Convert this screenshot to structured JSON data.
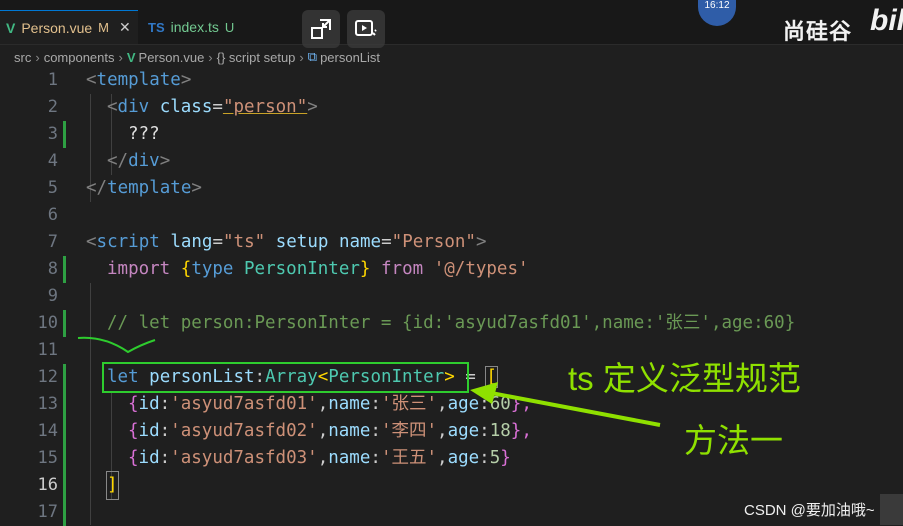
{
  "tabs": [
    {
      "icon": "V",
      "label": "Person.vue",
      "badge": "M",
      "close": "✕"
    },
    {
      "icon": "TS",
      "label": "index.ts",
      "badge": "U"
    }
  ],
  "clock": "16:12",
  "watermark": "尚硅谷",
  "watermark_logo": "bili",
  "breadcrumb": {
    "src": "src",
    "components": "components",
    "file": "Person.vue",
    "script": "{} script setup",
    "symbol": "personList"
  },
  "line_numbers": [
    "1",
    "2",
    "3",
    "4",
    "5",
    "6",
    "7",
    "8",
    "9",
    "10",
    "11",
    "12",
    "13",
    "14",
    "15",
    "16",
    "17"
  ],
  "code": {
    "l1_open": "<",
    "l1_tag": "template",
    "l1_close": ">",
    "l2_open": "<",
    "l2_tag": "div",
    "l2_attr": "class",
    "l2_eq": "=",
    "l2_val": "\"person\"",
    "l2_close": ">",
    "l3": "???",
    "l4_open": "</",
    "l4_tag": "div",
    "l4_close": ">",
    "l5_open": "</",
    "l5_tag": "template",
    "l5_close": ">",
    "l7_open": "<",
    "l7_tag": "script",
    "l7_attr1": "lang",
    "l7_eq1": "=",
    "l7_val1": "\"ts\"",
    "l7_attr2": "setup",
    "l7_attr3": "name",
    "l7_eq3": "=",
    "l7_val3": "\"Person\"",
    "l7_close": ">",
    "l8_import": "import",
    "l8_lb": "{",
    "l8_type": "type",
    "l8_name": "PersonInter",
    "l8_rb": "}",
    "l8_from": "from",
    "l8_path": "'@/types'",
    "l10": "// let person:PersonInter = {id:'asyud7asfd01',name:'张三',age:60}",
    "l12_let": "let",
    "l12_var": "personList",
    "l12_colon": ":",
    "l12_arr": "Array",
    "l12_lt": "<",
    "l12_pi": "PersonInter",
    "l12_gt": ">",
    "l12_eq": " = ",
    "l12_lb": "[",
    "l13_lb": "{",
    "l13_k1": "id",
    "l13_v1": "'asyud7asfd01'",
    "l13_k2": "name",
    "l13_v2": "'张三'",
    "l13_k3": "age",
    "l13_v3": "60",
    "l13_rb": "},",
    "l14_lb": "{",
    "l14_k1": "id",
    "l14_v1": "'asyud7asfd02'",
    "l14_k2": "name",
    "l14_v2": "'李四'",
    "l14_k3": "age",
    "l14_v3": "18",
    "l14_rb": "},",
    "l15_lb": "{",
    "l15_k1": "id",
    "l15_v1": "'asyud7asfd03'",
    "l15_k2": "name",
    "l15_v2": "'王五'",
    "l15_k3": "age",
    "l15_v3": "5",
    "l15_rb": "}",
    "l16": "]"
  },
  "annotations": {
    "title": "ts 定义泛型规范",
    "method": "方法一"
  },
  "credit": "CSDN @要加油哦~",
  "colors": {
    "annotation_green": "#8fe000",
    "box_green": "#2ecc2e",
    "tab_accent": "#0078d4"
  }
}
